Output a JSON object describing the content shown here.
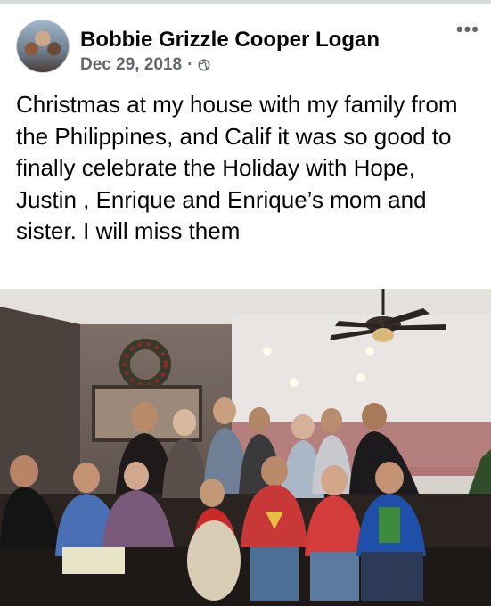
{
  "post": {
    "author": "Bobbie Grizzle Cooper Logan",
    "date": "Dec 29, 2018",
    "separator": "·",
    "privacy_icon": "globe-icon",
    "more_icon": "more-options-icon",
    "more_label": "•••",
    "text": "Christmas at my house with my family from the Philippines, and Calif it was so good to finally celebrate the Holiday with Hope, Justin , Enrique and Enrique’s mom and sister. I will miss them"
  },
  "colors": {
    "author_text": "#050505",
    "meta_text": "#65676b",
    "top_divider": "#d9dadc"
  }
}
